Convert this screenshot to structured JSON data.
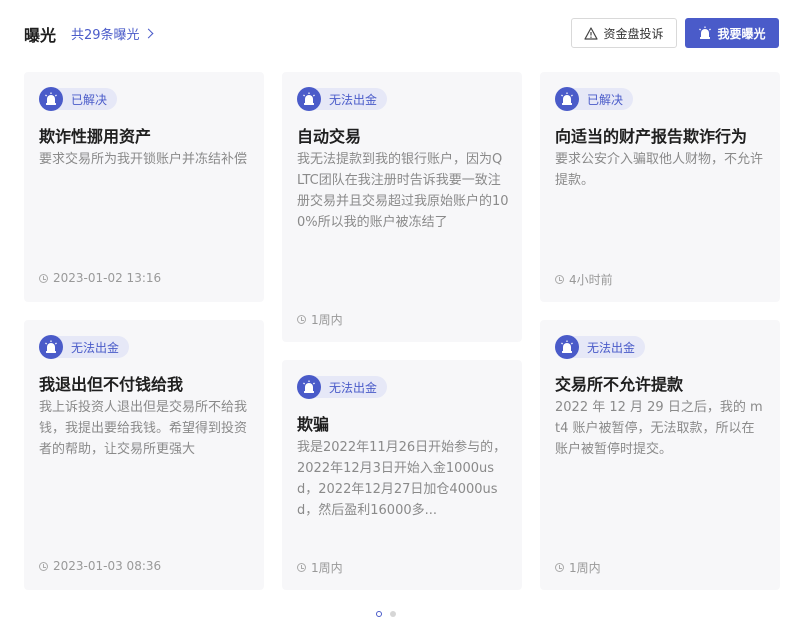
{
  "header": {
    "title": "曝光",
    "count_link": "共29条曝光",
    "complaint_button": "资金盘投诉",
    "expose_button": "我要曝光"
  },
  "cards": [
    {
      "status": "已解决",
      "title": "欺诈性挪用资产",
      "desc": "要求交易所为我开锁账户并冻结补偿",
      "time": "2023-01-02 13:16"
    },
    {
      "status": "无法出金",
      "title": "自动交易",
      "desc": "我无法提款到我的银行账户，因为QLTC团队在我注册时告诉我要一致注册交易并且交易超过我原始账户的100%所以我的账户被冻结了",
      "time": "1周内"
    },
    {
      "status": "已解决",
      "title": "向适当的财产报告欺诈行为",
      "desc": "要求公安介入骗取他人财物，不允许提款。",
      "time": "4小时前"
    },
    {
      "status": "无法出金",
      "title": "我退出但不付钱给我",
      "desc": "我上诉投资人退出但是交易所不给我钱，我提出要给我钱。希望得到投资者的帮助，让交易所更强大",
      "time": "2023-01-03 08:36"
    },
    {
      "status": "无法出金",
      "title": "欺骗",
      "desc": "我是2022年11月26日开始参与的，2022年12月3日开始入金1000usd，2022年12月27日加仓4000usd，然后盈利16000多...",
      "time": "1周内"
    },
    {
      "status": "无法出金",
      "title": "交易所不允许提款",
      "desc": "2022 年 12 月 29 日之后，我的 mt4 账户被暂停，无法取款，所以在账户被暂停时提交。",
      "time": "1周内"
    }
  ],
  "pagination": {
    "pages": 2,
    "current": 1
  },
  "colors": {
    "accent": "#4a5bc9",
    "card_bg": "#f7f7f9",
    "pill_bg": "#e6e8f7"
  }
}
